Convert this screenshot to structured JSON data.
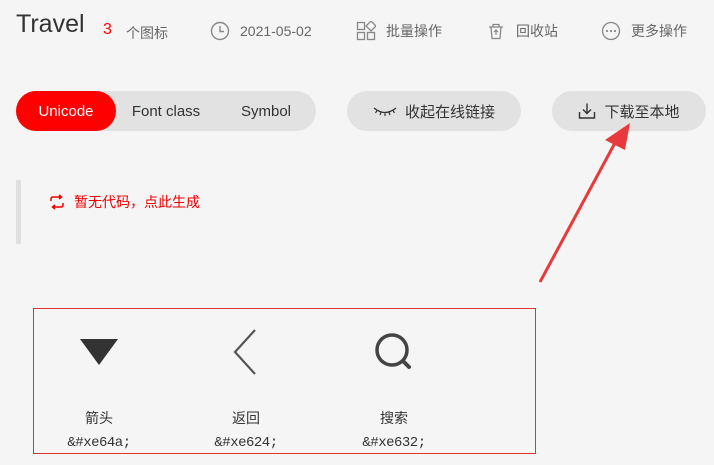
{
  "header": {
    "title": "Travel",
    "icon_count": "3",
    "icon_count_label": "个图标",
    "date": "2021-05-02",
    "batch_ops": "批量操作",
    "recycle": "回收站",
    "more_ops": "更多操作"
  },
  "tabs": [
    {
      "label": "Unicode",
      "active": true
    },
    {
      "label": "Font class",
      "active": false
    },
    {
      "label": "Symbol",
      "active": false
    }
  ],
  "buttons": {
    "collapse_link": "收起在线链接",
    "download": "下载至本地"
  },
  "code_area": {
    "message": "暂无代码，点此生成"
  },
  "icons": [
    {
      "name": "箭头",
      "code": "&#xe64a;",
      "icon": "triangle-down-icon"
    },
    {
      "name": "返回",
      "code": "&#xe624;",
      "icon": "chevron-left-icon"
    },
    {
      "name": "搜索",
      "code": "&#xe632;",
      "icon": "search-icon"
    }
  ],
  "colors": {
    "accent": "#ff0000",
    "annotation": "#dd3333",
    "pill_bg": "#e2e2e2",
    "page_bg": "#f5f5f5"
  }
}
